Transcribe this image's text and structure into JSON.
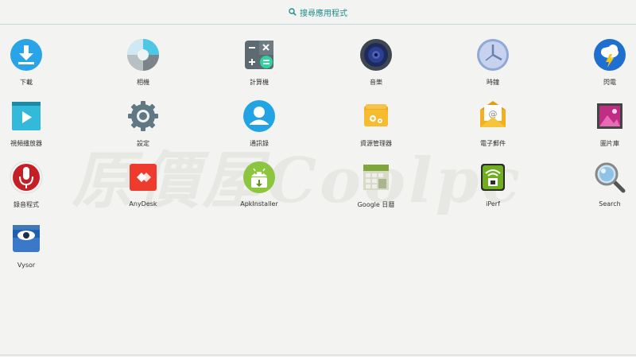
{
  "search": {
    "label": "搜尋應用程式"
  },
  "apps": [
    {
      "label": "下載",
      "icon": "download-icon"
    },
    {
      "label": "相機",
      "icon": "camera-icon"
    },
    {
      "label": "計算機",
      "icon": "calculator-icon"
    },
    {
      "label": "音樂",
      "icon": "music-icon"
    },
    {
      "label": "時鐘",
      "icon": "clock-icon"
    },
    {
      "label": "閃電",
      "icon": "flash-icon"
    },
    {
      "label": "視頻播放器",
      "icon": "video-player-icon"
    },
    {
      "label": "設定",
      "icon": "settings-icon"
    },
    {
      "label": "通訊錄",
      "icon": "contacts-icon"
    },
    {
      "label": "資源管理器",
      "icon": "file-manager-icon"
    },
    {
      "label": "電子郵件",
      "icon": "email-icon"
    },
    {
      "label": "圖片庫",
      "icon": "gallery-icon"
    },
    {
      "label": "錄音程式",
      "icon": "recorder-icon"
    },
    {
      "label": "AnyDesk",
      "icon": "anydesk-icon"
    },
    {
      "label": "ApkInstaller",
      "icon": "apkinstaller-icon"
    },
    {
      "label": "Google 日曆",
      "icon": "calendar-icon"
    },
    {
      "label": "iPerf",
      "icon": "iperf-icon"
    },
    {
      "label": "Search",
      "icon": "search-app-icon"
    },
    {
      "label": "Vysor",
      "icon": "vysor-icon"
    }
  ],
  "watermark": {
    "text": "原價屋Coolpc"
  }
}
